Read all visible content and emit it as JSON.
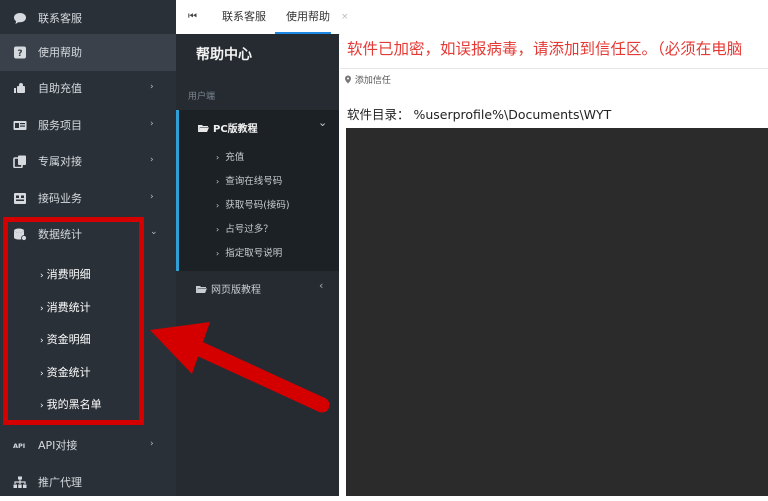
{
  "sidebar": {
    "items": [
      {
        "label": "联系客服",
        "icon": "chat-bubble-icon",
        "has_arrow": false
      },
      {
        "label": "使用帮助",
        "icon": "question-icon",
        "has_arrow": false
      },
      {
        "label": "自助充值",
        "icon": "recharge-icon",
        "has_arrow": true
      },
      {
        "label": "服务项目",
        "icon": "id-card-icon",
        "has_arrow": true
      },
      {
        "label": "专属对接",
        "icon": "copy-icon",
        "has_arrow": true
      },
      {
        "label": "接码业务",
        "icon": "message-icon",
        "has_arrow": true
      },
      {
        "label": "数据统计",
        "icon": "database-icon",
        "has_arrow": true
      },
      {
        "label": "API对接",
        "icon": "api-icon",
        "has_arrow": true
      },
      {
        "label": "推广代理",
        "icon": "sitemap-icon",
        "has_arrow": false
      }
    ],
    "sub_items": [
      "消费明细",
      "消费统计",
      "资金明细",
      "资金统计",
      "我的黑名单"
    ],
    "arrow_right": "›",
    "arrow_down": "⌄"
  },
  "tabs": {
    "nav_icon": "⏮",
    "items": [
      "联系客服",
      "使用帮助"
    ],
    "close": "×"
  },
  "help": {
    "title": "帮助中心",
    "section": "用户端",
    "pc_label": "PC版教程",
    "pc_links": [
      "充值",
      "查询在线号码",
      "获取号码(接码)",
      "占号过多？",
      "指定取号说明"
    ],
    "web_label": "网页版教程",
    "chev_down": "⌄",
    "chev_left": "‹"
  },
  "content": {
    "notice": "软件已加密，如误报病毒，请添加到信任区。（必须在电脑",
    "trust_label": "添加信任",
    "path_label": "软件目录：  %userprofile%\\Documents\\WYT"
  },
  "colors": {
    "sidebar_bg": "#2a3038",
    "active_bg": "#3a414a",
    "help_bg": "#252b31",
    "accent": "#2f9fd4",
    "notice": "#e53935",
    "annotation": "#d40000"
  }
}
